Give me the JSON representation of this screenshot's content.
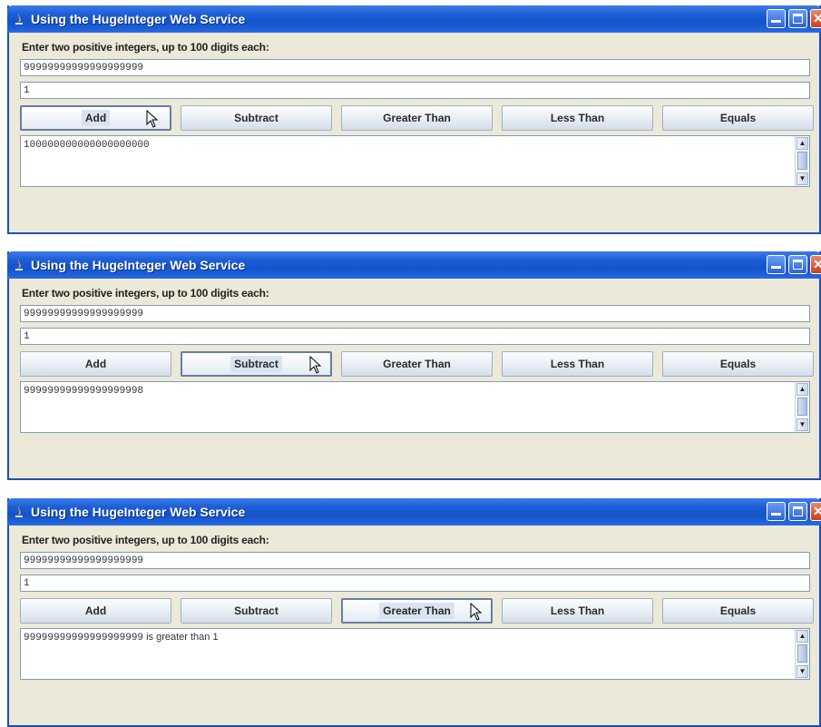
{
  "windows": [
    {
      "title": "Using the HugeInteger Web Service",
      "prompt": "Enter two positive integers, up to 100 digits each:",
      "first_integer": "99999999999999999999",
      "second_integer": "1",
      "buttons": [
        "Add",
        "Subtract",
        "Greater Than",
        "Less Than",
        "Equals"
      ],
      "pressed_button": "Add",
      "result": "100000000000000000000",
      "result_suffix": ""
    },
    {
      "title": "Using the HugeInteger Web Service",
      "prompt": "Enter two positive integers, up to 100 digits each:",
      "first_integer": "99999999999999999999",
      "second_integer": "1",
      "buttons": [
        "Add",
        "Subtract",
        "Greater Than",
        "Less Than",
        "Equals"
      ],
      "pressed_button": "Subtract",
      "result": "99999999999999999998",
      "result_suffix": ""
    },
    {
      "title": "Using the HugeInteger Web Service",
      "prompt": "Enter two positive integers, up to 100 digits each:",
      "first_integer": "99999999999999999999",
      "second_integer": "1",
      "buttons": [
        "Add",
        "Subtract",
        "Greater Than",
        "Less Than",
        "Equals"
      ],
      "pressed_button": "Greater Than",
      "result": "99999999999999999999",
      "result_suffix": " is greater than 1"
    }
  ],
  "colors": {
    "titlebar": "#1f5fd6",
    "window_bg": "#ece9d8",
    "field_border": "#7f9db9"
  },
  "icons": {
    "app": "java-cup-icon",
    "minimize": "minimize-icon",
    "maximize": "maximize-icon",
    "close": "close-icon",
    "cursor": "mouse-pointer-icon"
  }
}
